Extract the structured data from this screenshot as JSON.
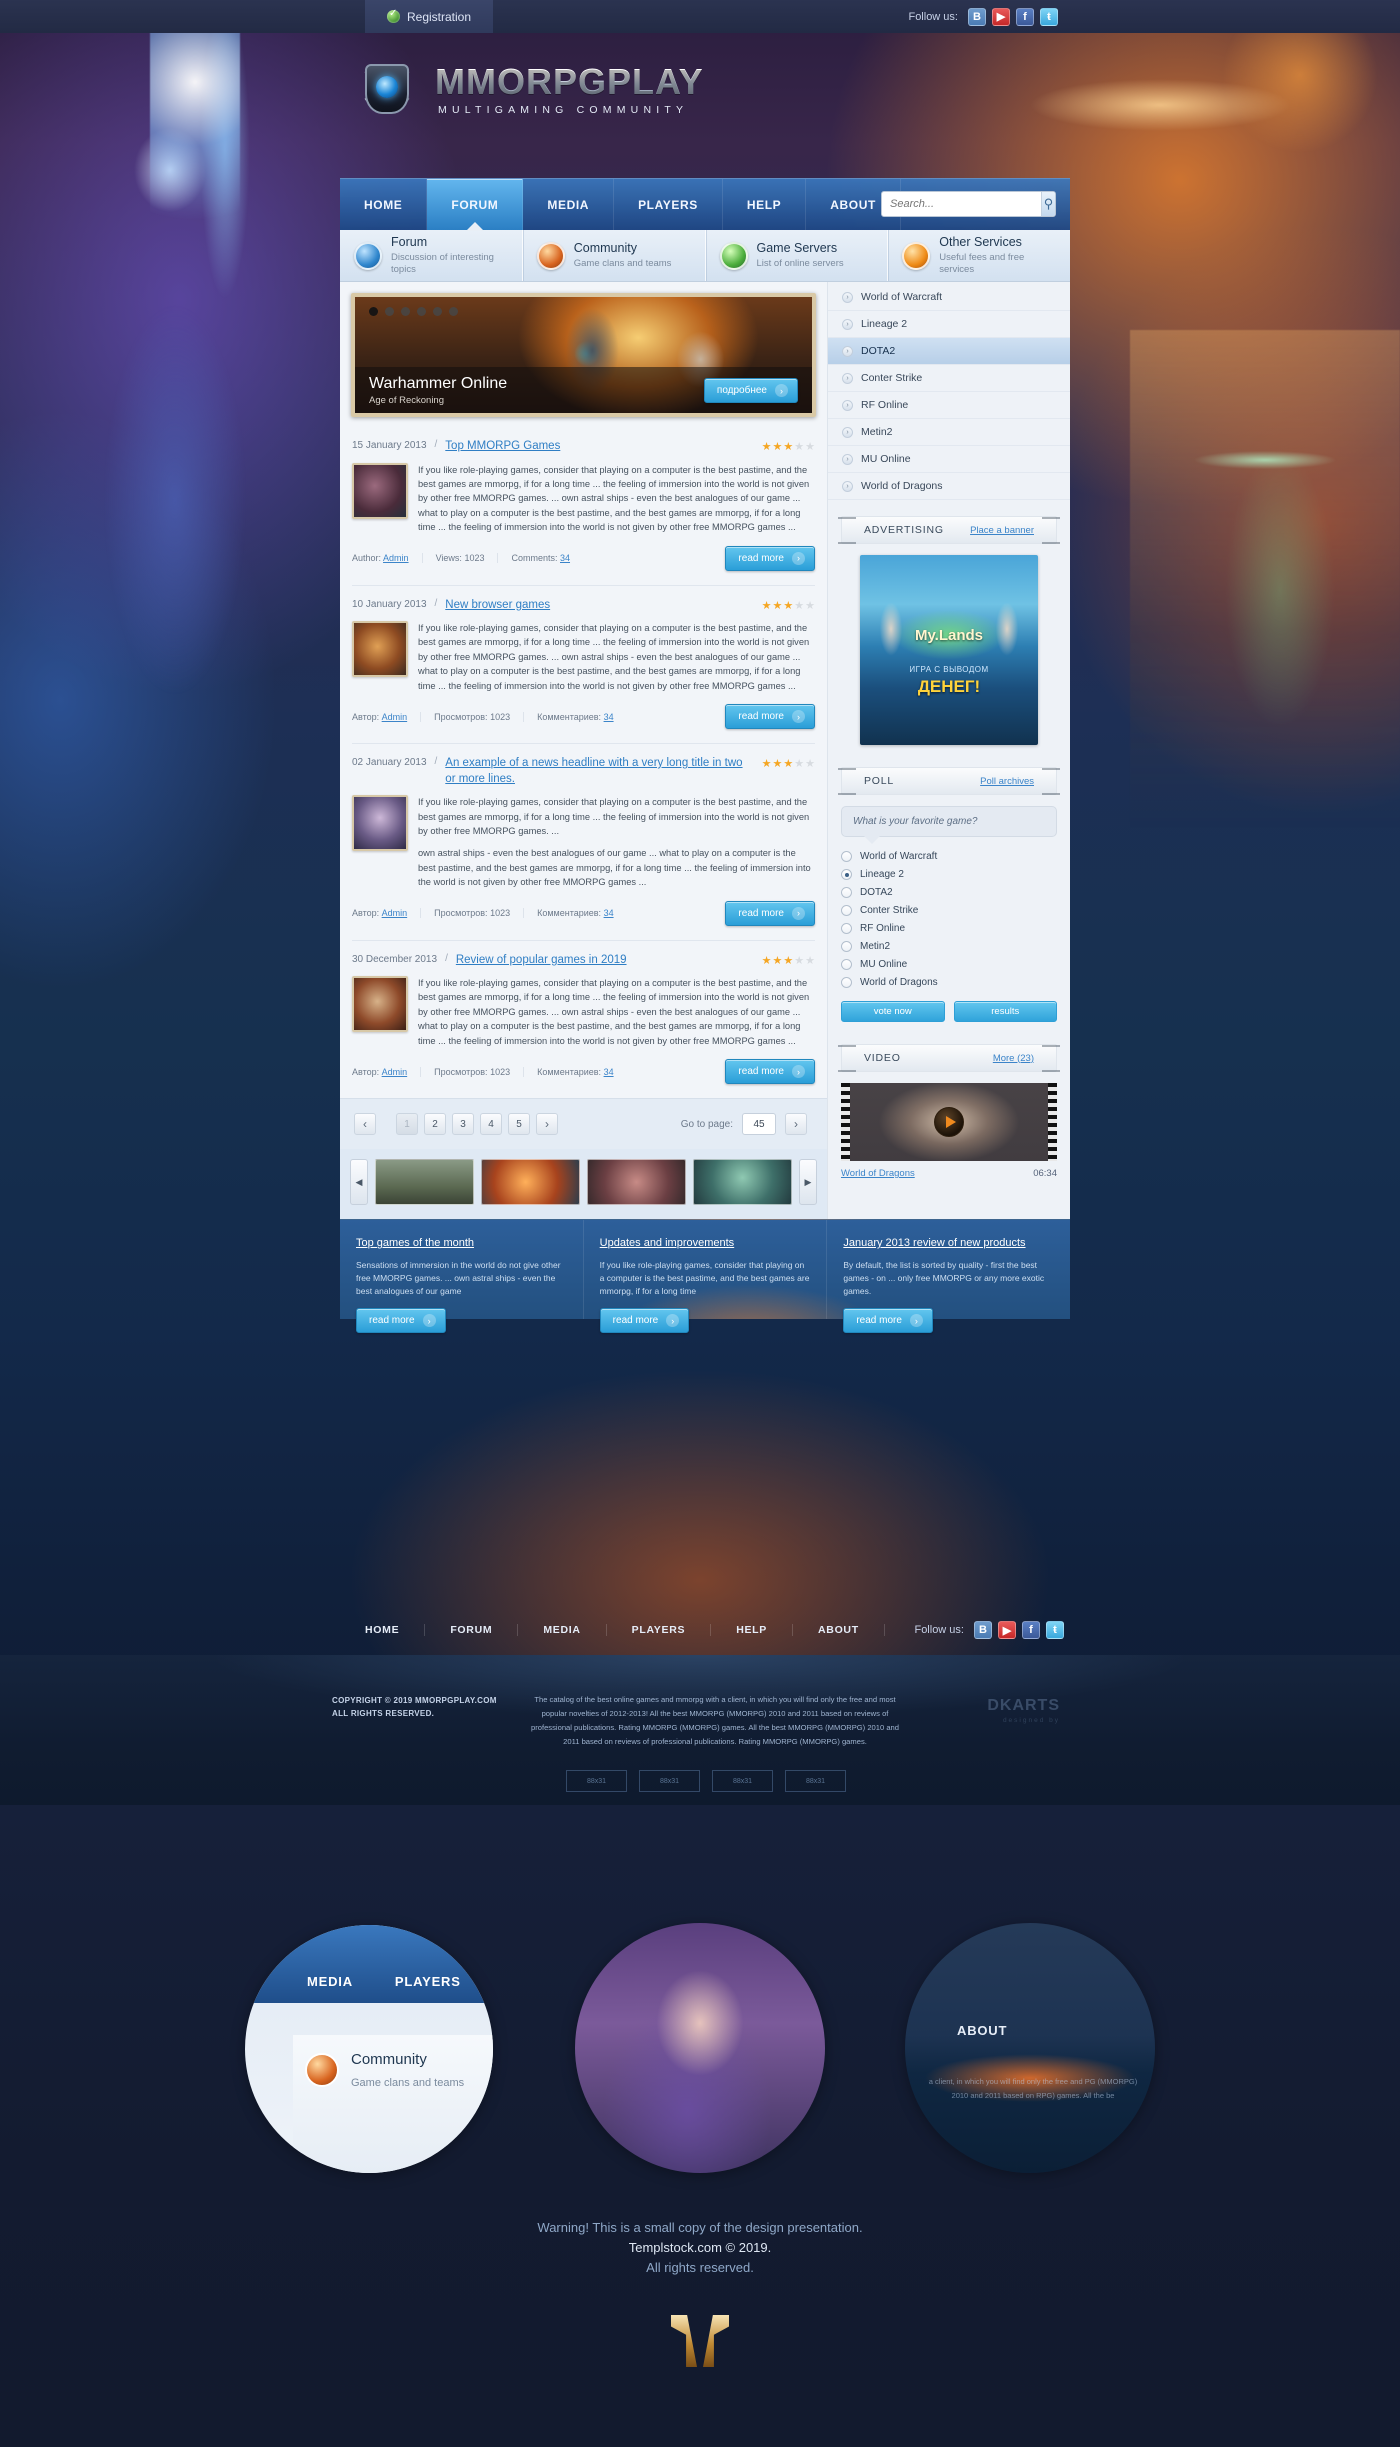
{
  "topbar": {
    "registration": "Registration",
    "follow_label": "Follow us:",
    "socials": [
      {
        "name": "vk-icon",
        "glyph": "B"
      },
      {
        "name": "youtube-icon",
        "glyph": "▶"
      },
      {
        "name": "facebook-icon",
        "glyph": "f"
      },
      {
        "name": "twitter-icon",
        "glyph": "ŧ"
      }
    ]
  },
  "logo": {
    "title": "MMORPGPLAY",
    "subtitle": "MULTIGAMING COMMUNITY"
  },
  "nav": {
    "items": [
      "HOME",
      "FORUM",
      "MEDIA",
      "PLAYERS",
      "HELP",
      "ABOUT"
    ],
    "active": "FORUM",
    "search_placeholder": "Search...",
    "search_value": ""
  },
  "categories": [
    {
      "title": "Forum",
      "desc": "Discussion of interesting topics",
      "icon": "forum-icon"
    },
    {
      "title": "Community",
      "desc": "Game clans and teams",
      "icon": "community-icon"
    },
    {
      "title": "Game Servers",
      "desc": "List of online servers",
      "icon": "servers-icon"
    },
    {
      "title": "Other Services",
      "desc": "Useful fees and free services",
      "icon": "other-services-icon"
    }
  ],
  "slider": {
    "title": "Warhammer Online",
    "subtitle": "Age of Reckoning",
    "button": "подробнее",
    "dots": 6,
    "active_dot": 1
  },
  "news": [
    {
      "date": "15 January 2013",
      "title": "Top MMORPG Games",
      "rating": 3,
      "paragraphs": [
        "If you like role-playing games, consider that playing on a computer is the best pastime, and the best games are mmorpg, if for a long time ... the feeling of immersion into the world is not given by other free MMORPG games. ... own astral ships - even the best analogues of our game ... what to play on a computer is the best pastime, and the best games are mmorpg, if for a long time ... the feeling of immersion into the world is not given by other free MMORPG games ..."
      ],
      "meta": [
        {
          "label": "Author:",
          "value": "Admin",
          "link": true
        },
        {
          "label": "Views:",
          "value": "1023",
          "link": false
        },
        {
          "label": "Comments:",
          "value": "34",
          "link": true
        }
      ],
      "read_more": "read more"
    },
    {
      "date": "10 January 2013",
      "title": "New browser games",
      "rating": 3,
      "paragraphs": [
        "If you like role-playing games, consider that playing on a computer is the best pastime, and the best games are mmorpg, if for a long time ... the feeling of immersion into the world is not given by other free MMORPG games. ... own astral ships - even the best analogues of our game ... what to play on a computer is the best pastime, and the best games are mmorpg, if for a long time ... the feeling of immersion into the world is not given by other free MMORPG games ..."
      ],
      "meta": [
        {
          "label": "Автор:",
          "value": "Admin",
          "link": true
        },
        {
          "label": "Просмотров:",
          "value": "1023",
          "link": false
        },
        {
          "label": "Комментариев:",
          "value": "34",
          "link": true
        }
      ],
      "read_more": "read more"
    },
    {
      "date": "02 January 2013",
      "title": "An example of a news headline with a very long title in two or more lines.",
      "rating": 3,
      "paragraphs": [
        "If you like role-playing games, consider that playing on a computer is the best pastime, and the best games are mmorpg, if for a long time ... the feeling of immersion into the world is not given by other free MMORPG games. ...",
        "own astral ships - even the best analogues of our game ... what to play on a computer is the best pastime, and the best games are mmorpg, if for a long time ... the feeling of immersion into the world is not given by other free MMORPG games ..."
      ],
      "meta": [
        {
          "label": "Автор:",
          "value": "Admin",
          "link": true
        },
        {
          "label": "Просмотров:",
          "value": "1023",
          "link": false
        },
        {
          "label": "Комментариев:",
          "value": "34",
          "link": true
        }
      ],
      "read_more": "read more"
    },
    {
      "date": "30 December 2013",
      "title": "Review of popular games in 2019",
      "rating": 3,
      "paragraphs": [
        "If you like role-playing games, consider that playing on a computer is the best pastime, and the best games are mmorpg, if for a long time ... the feeling of immersion into the world is not given by other free MMORPG games. ... own astral ships - even the best analogues of our game ... what to play on a computer is the best pastime, and the best games are mmorpg, if for a long time ... the feeling of immersion into the world is not given by other free MMORPG games ..."
      ],
      "meta": [
        {
          "label": "Автор:",
          "value": "Admin",
          "link": true
        },
        {
          "label": "Просмотров:",
          "value": "1023",
          "link": false
        },
        {
          "label": "Комментариев:",
          "value": "34",
          "link": true
        }
      ],
      "read_more": "read more"
    }
  ],
  "pagination": {
    "prev": "‹",
    "next": "›",
    "pages": [
      "1",
      "2",
      "3",
      "4",
      "5"
    ],
    "current": "1",
    "goto_label": "Go to page:",
    "goto_value": "45",
    "goto_go": "›"
  },
  "gallery": {
    "prev": "◀",
    "next": "▶",
    "thumbs": [
      "gallery-thumb-1",
      "gallery-thumb-2",
      "gallery-thumb-3",
      "gallery-thumb-4"
    ]
  },
  "sidebar": {
    "games": [
      "World of Warcraft",
      "Lineage 2",
      "DOTA2",
      "Conter Strike",
      "RF Online",
      "Metin2",
      "MU Online",
      "World of Dragons"
    ],
    "active_game": "DOTA2",
    "advertising": {
      "title": "ADVERTISING",
      "link": "Place a banner",
      "banner_title": "My.Lands",
      "banner_sub": "ИГРА С ВЫВОДОМ",
      "banner_money": "ДЕНЕГ!"
    },
    "poll": {
      "title": "POLL",
      "link": "Poll archives",
      "question": "What is your favorite game?",
      "options": [
        "World of Warcraft",
        "Lineage 2",
        "DOTA2",
        "Conter Strike",
        "RF Online",
        "Metin2",
        "MU Online",
        "World of Dragons"
      ],
      "selected": "Lineage 2",
      "vote_button": "vote now",
      "results_button": "results"
    },
    "video": {
      "title": "VIDEO",
      "link": "More (23)",
      "item_name": "World of Dragons",
      "item_time": "06:34"
    }
  },
  "promo": [
    {
      "title": "Top games of the month",
      "text": "Sensations of immersion in the world do not give other free MMORPG games. ... own astral ships - even the best analogues of our game",
      "button": "read more"
    },
    {
      "title": "Updates and improvements",
      "text": "If you like role-playing games, consider that playing on a computer is the best pastime, and the best games are mmorpg, if for a long time",
      "button": "read more"
    },
    {
      "title": "January 2013 review of new products",
      "text": "By default, the list is sorted by quality - first the best games - on ... only free MMORPG or any more exotic games.",
      "button": "read more"
    }
  ],
  "footer": {
    "nav": [
      "HOME",
      "FORUM",
      "MEDIA",
      "PLAYERS",
      "HELP",
      "ABOUT"
    ],
    "follow_label": "Follow us:",
    "copyright_line1": "COPYRIGHT © 2019 MMORPGPLAY.COM",
    "copyright_line2": "ALL RIGHTS RESERVED.",
    "description": "The catalog of the best online games and mmorpg with a client, in which you will find only the free and most popular novelties of 2012-2013! All the best MMORPG (MMORPG) 2010 and 2011 based on reviews of professional publications. Rating MMORPG (MMORPG) games. All the best MMORPG (MMORPG) 2010 and 2011 based on reviews of professional publications. Rating MMORPG (MMORPG) games.",
    "author_logo": "DKARTS",
    "author_sub": "designed by",
    "banners": [
      "88x31",
      "88x31",
      "88x31",
      "88x31"
    ]
  },
  "presentation": {
    "circle1_nav": [
      "MEDIA",
      "PLAYERS"
    ],
    "circle1_card_title": "Community",
    "circle1_card_desc": "Game clans and teams",
    "circle3_label": "ABOUT",
    "circle3_text": "a client, in which you will find only the free and PG (MMORPG) 2010 and 2011 based on RPG) games. All the be",
    "warning_line1": "Warning! This is a small copy of the design presentation.",
    "warning_line2": "Templstock.com © 2019.",
    "warning_line3": "All rights reserved."
  }
}
